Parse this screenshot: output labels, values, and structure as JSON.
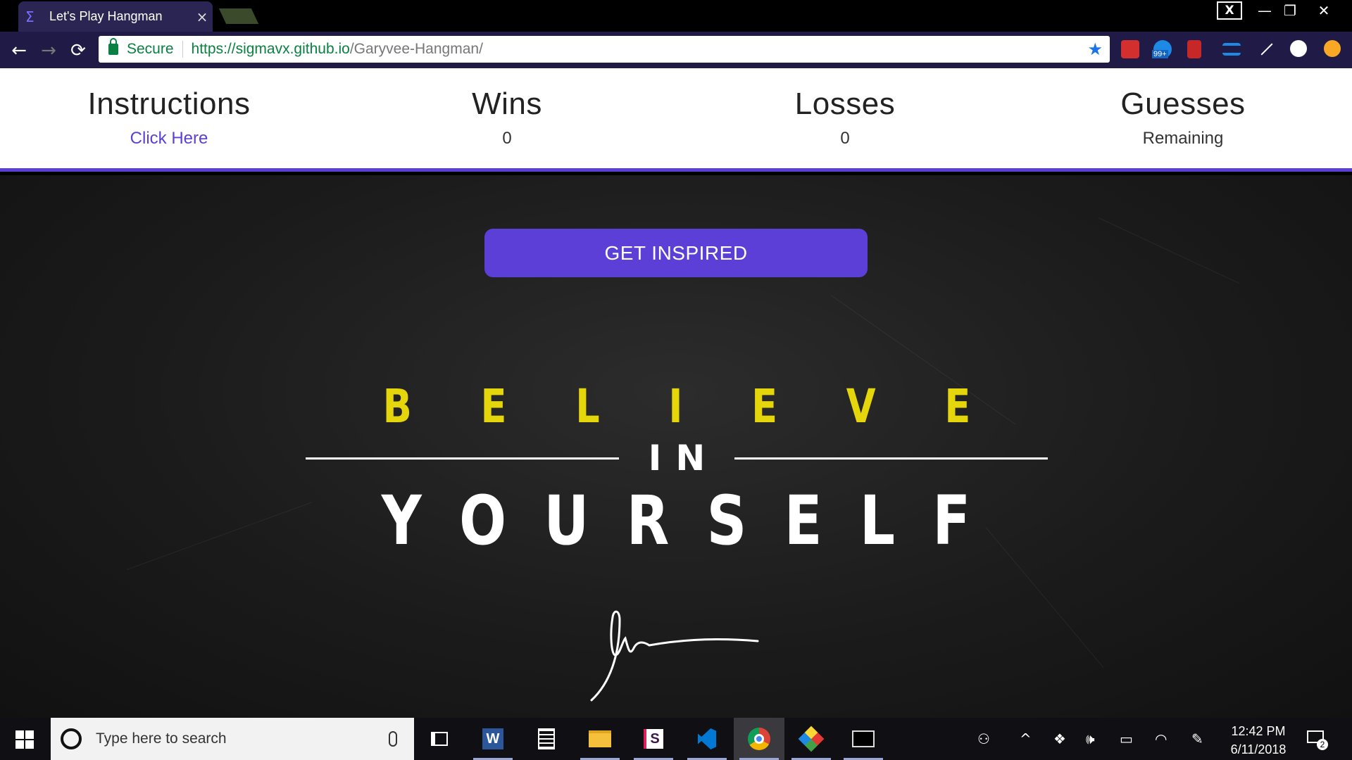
{
  "browser": {
    "tab_title": "Let's Play Hangman",
    "tab_close": "×",
    "window_controls": [
      "X",
      "—",
      "❐",
      "✕"
    ],
    "secure_label": "Secure",
    "url_host": "https://sigmavx.github.io",
    "url_path": "/Garyvee-Hangman/",
    "extension_badge": "99+"
  },
  "stats": [
    {
      "heading": "Instructions",
      "value": "Click Here"
    },
    {
      "heading": "Wins",
      "value": "0"
    },
    {
      "heading": "Losses",
      "value": "0"
    },
    {
      "heading": "Guesses",
      "value": "Remaining"
    }
  ],
  "main": {
    "inspire_button": "GET INSPIRED",
    "believe_letters": [
      "B",
      "E",
      "L",
      "I",
      "E",
      "V",
      "E"
    ],
    "in_text": "IN",
    "yourself_letters": [
      "Y",
      "O",
      "U",
      "R",
      "S",
      "E",
      "L",
      "F"
    ],
    "accent_color": "#5b3fd6",
    "believe_color": "#e5d50b"
  },
  "taskbar": {
    "search_placeholder": "Type here to search",
    "time": "12:42 PM",
    "date": "6/11/2018",
    "notification_count": "2",
    "apps": [
      "task-view",
      "word",
      "calculator",
      "file-explorer",
      "slack",
      "vscode",
      "chrome",
      "gitkraken",
      "terminal"
    ]
  }
}
